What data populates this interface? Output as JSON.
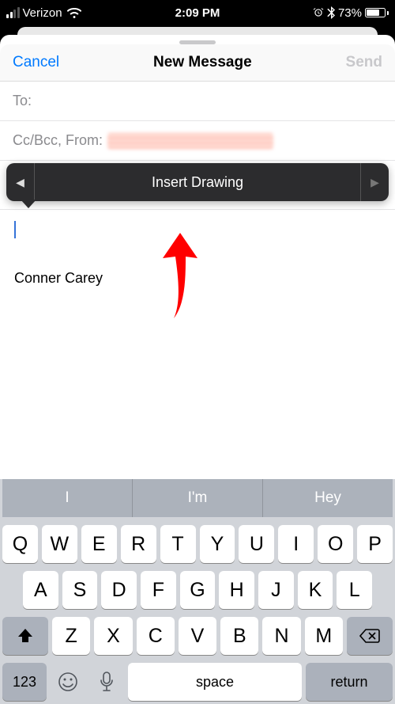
{
  "status": {
    "carrier": "Verizon",
    "time": "2:09 PM",
    "battery": "73%",
    "alarm": "⏰",
    "bt": "✱"
  },
  "nav": {
    "cancel": "Cancel",
    "title": "New Message",
    "send": "Send"
  },
  "fields": {
    "to_label": "To:",
    "ccbcc_label": "Cc/Bcc, From:"
  },
  "popover": {
    "action": "Insert Drawing"
  },
  "body": {
    "signature": "Conner Carey"
  },
  "suggestions": [
    "I",
    "I'm",
    "Hey"
  ],
  "keyboard": {
    "row1": [
      "Q",
      "W",
      "E",
      "R",
      "T",
      "Y",
      "U",
      "I",
      "O",
      "P"
    ],
    "row2": [
      "A",
      "S",
      "D",
      "F",
      "G",
      "H",
      "J",
      "K",
      "L"
    ],
    "row3": [
      "Z",
      "X",
      "C",
      "V",
      "B",
      "N",
      "M"
    ],
    "numKey": "123",
    "space": "space",
    "return": "return"
  }
}
